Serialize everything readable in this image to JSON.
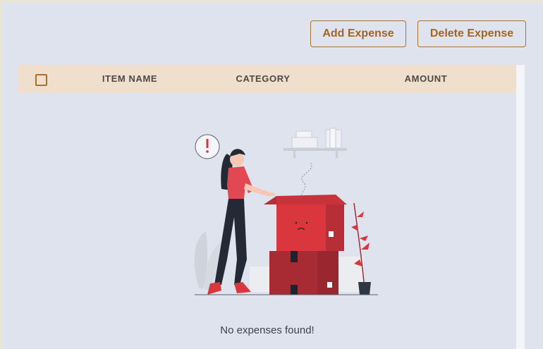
{
  "toolbar": {
    "add_label": "Add Expense",
    "delete_label": "Delete Expense"
  },
  "table": {
    "columns": [
      "ITEM NAME",
      "CATEGORY",
      "AMOUNT"
    ],
    "rows": [],
    "empty_message": "No expenses found!"
  },
  "colors": {
    "accent": "#a9712d",
    "header_bg": "#f0dfcc",
    "panel_bg": "#dfe3ed",
    "box_red": "#d9363e",
    "box_dark_red": "#a82a33"
  },
  "icons": {
    "select_all": "checkbox-icon",
    "empty_state": "empty-box-illustration"
  }
}
